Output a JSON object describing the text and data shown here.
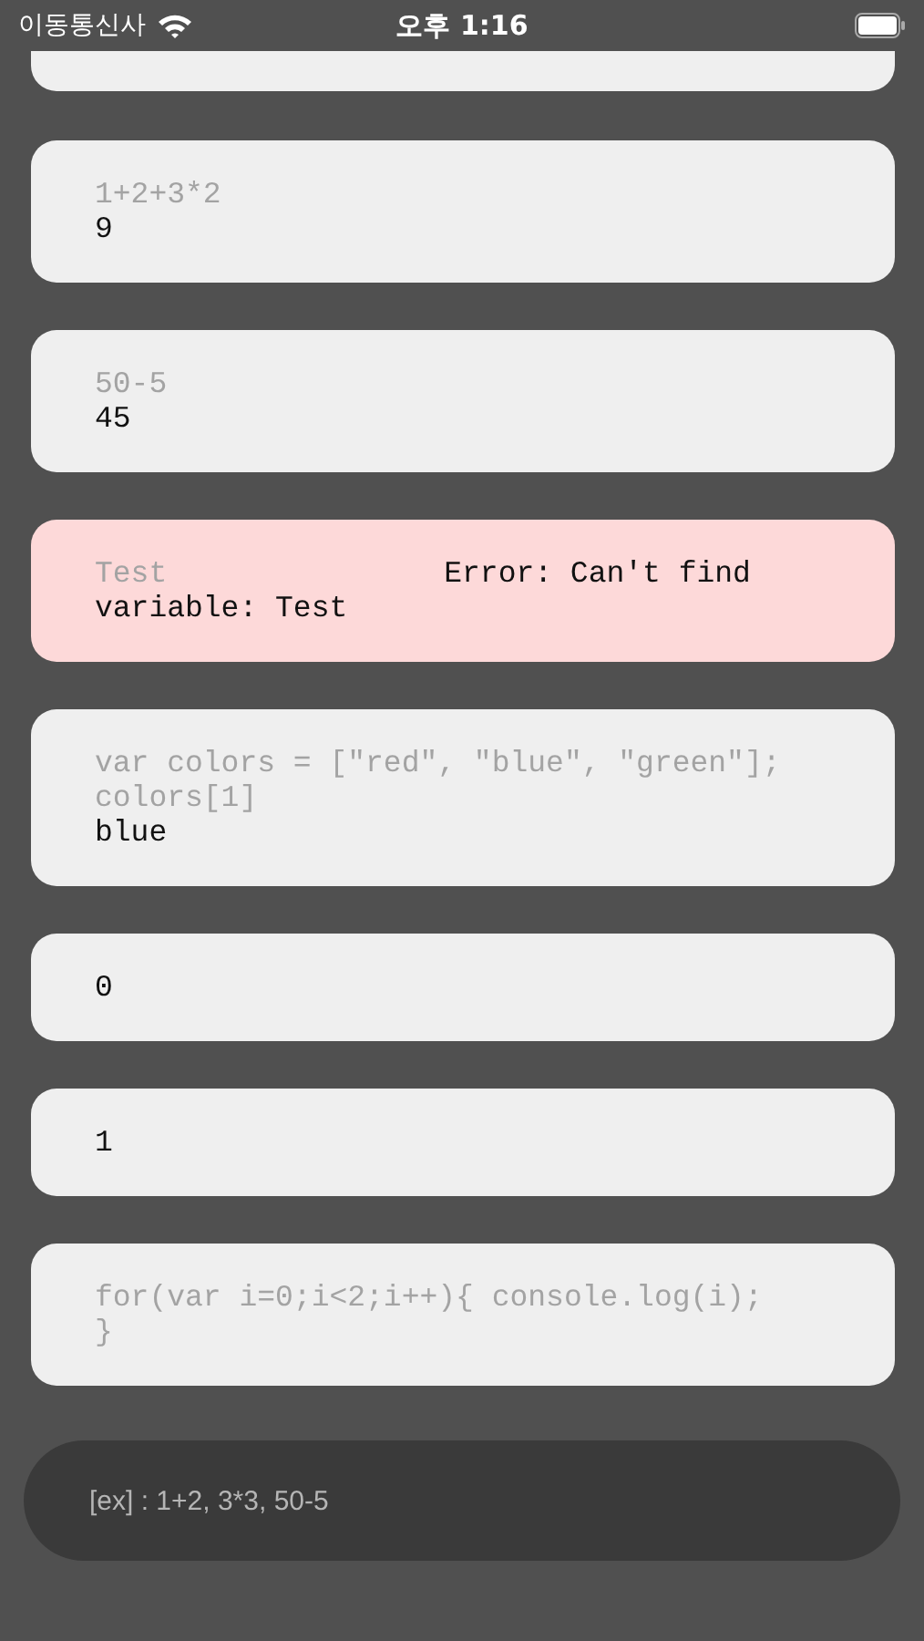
{
  "status_bar": {
    "carrier": "이동통신사",
    "time": "오후 1:16"
  },
  "cards": [
    {
      "kind": "clipped"
    },
    {
      "kind": "result",
      "input": "1+2+3*2",
      "output": "9"
    },
    {
      "kind": "result",
      "input": "50-5",
      "output": "45"
    },
    {
      "kind": "error",
      "input": "Test",
      "output": "Error: Can't find variable: Test"
    },
    {
      "kind": "result",
      "input": "var colors = [\"red\", \"blue\", \"green\"]; colors[1]",
      "output": "blue"
    },
    {
      "kind": "result",
      "output": "0"
    },
    {
      "kind": "result",
      "output": "1"
    },
    {
      "kind": "result",
      "input": "for(var i=0;i<2;i++){ console.log(i); }"
    }
  ],
  "input": {
    "placeholder": "[ex] : 1+2, 3*3, 50-5"
  }
}
